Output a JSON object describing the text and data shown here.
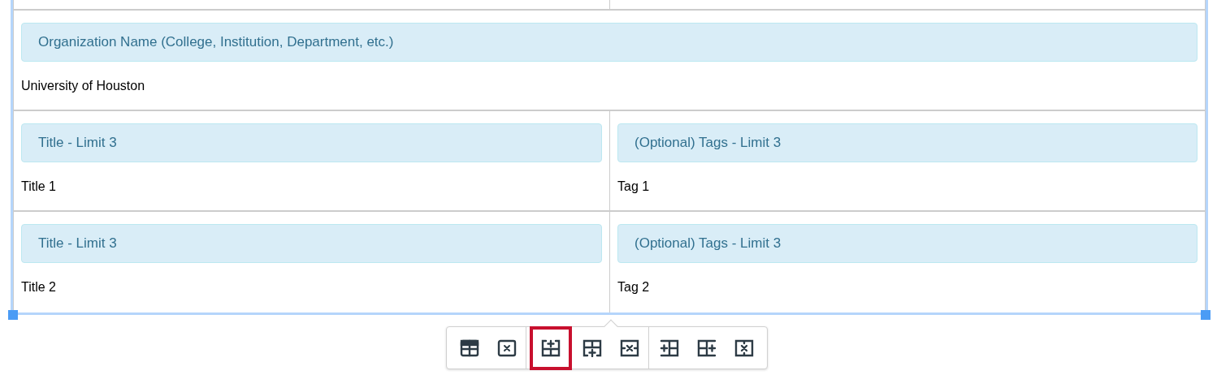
{
  "table": {
    "selected": true,
    "rows": [
      {
        "cells": [
          {
            "label": "Organization Name (College, Institution, Department, etc.)",
            "value": "University of Houston"
          }
        ]
      },
      {
        "cells": [
          {
            "label": "Title - Limit 3",
            "value": "Title 1"
          },
          {
            "label": "(Optional) Tags - Limit 3",
            "value": "Tag 1"
          }
        ]
      },
      {
        "cells": [
          {
            "label": "Title - Limit 3",
            "value": "Title 2"
          },
          {
            "label": "(Optional) Tags - Limit 3",
            "value": "Tag 2"
          }
        ]
      }
    ]
  },
  "toolbar": {
    "groups": [
      {
        "buttons": [
          {
            "kind": "table-properties",
            "selected": false
          },
          {
            "kind": "delete-table",
            "selected": false
          }
        ]
      },
      {
        "buttons": [
          {
            "kind": "row-above",
            "selected": true
          },
          {
            "kind": "row-below",
            "selected": false
          },
          {
            "kind": "delete-row",
            "selected": false
          }
        ]
      },
      {
        "buttons": [
          {
            "kind": "col-before",
            "selected": false
          },
          {
            "kind": "col-after",
            "selected": false
          },
          {
            "kind": "delete-col",
            "selected": false
          }
        ]
      }
    ]
  }
}
